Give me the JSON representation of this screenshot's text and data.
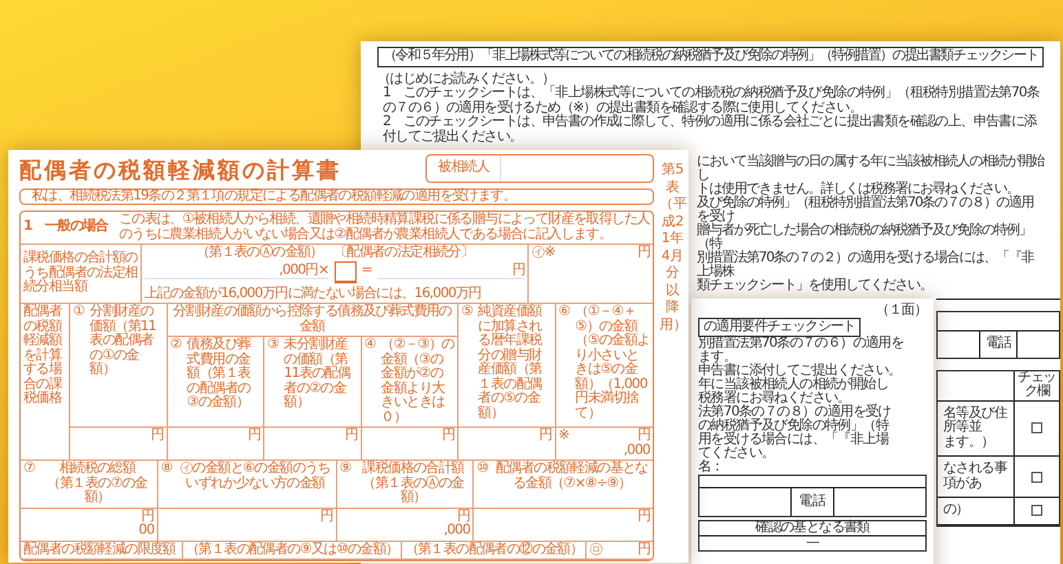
{
  "back_sheet": {
    "title": "（令和５年分用）「非上場株式等についての相続税の納税猶予及び免除の特例」（特例措置）の提出書類チェックシート",
    "intro": "（はじめにお読みください。）",
    "notes": [
      "1　このチェックシートは、「非上場株式等についての相続税の納税猶予及び免除の特例」（租税特別措置法第70条の７の６）の適用を受けるため（※）の提出書類を確認する際に使用してください。",
      "2　このチェックシートは、申告書の作成に際して、特例の適用に係る会社ごとに提出書類を確認の上、申告書に添付してご提出ください。"
    ],
    "note_fragments": [
      "において当該贈与の日の属する年に当該被相続人の相続が開始し",
      "トは使用できません。詳しくは税務署にお尋ねください。",
      "及び免除の特例」（租税特別措置法第70条の７の８）の適用を受け",
      "贈与者が死亡した場合の相続税の納税猶予及び免除の特例」（特",
      "別措置法第70条の７の２）の適用を受ける場合には、「『非上場株",
      "類チェックシート」を使用してください。"
    ],
    "phone_label": "電話",
    "check_table": {
      "header": "チェック欄",
      "rows": [
        {
          "lines": [
            "名等及び住所等並",
            "ます。）"
          ],
          "checked": false
        },
        {
          "lines": [
            "なされる事項があ"
          ],
          "checked": false
        },
        {
          "lines": [
            "の）"
          ],
          "checked": false
        }
      ]
    }
  },
  "middle_sheet": {
    "page_label": "（１面）",
    "title": "の適用要件チェックシート",
    "lines": [
      "別措置法第70条の７の６）の適用を",
      "ます。",
      "申告書に添付してご提出ください。",
      "年に当該被相続人の相続が開始し",
      "税務署にお尋ねください。",
      "法第70条の７の８）の適用を受け",
      "の納税猶予及び免除の特例」（特",
      "用を受ける場合には、「『非上場",
      "てください。"
    ],
    "name_label": "名：",
    "phone_label": "電話",
    "doc_header": "確認の基となる書類",
    "doc_row": "—"
  },
  "front_form": {
    "title": "配偶者の税額軽減額の計算書",
    "decedent_label": "被相続人",
    "side_label": "第5表（平成21年4月分以降用）",
    "declaration": "私は、相続税法第19条の２第１項の規定による配偶者の税額軽減の適用を受けます。",
    "section": {
      "label": "1　一般の場合",
      "note": "この表は、①被相続人から相続、遺贈や相続時精算課税に係る贈与によって財産を取得した人のうちに農業相続人がいない場合又は②配偶者が農業相続人である場合に記入します。"
    },
    "statutory_share": {
      "label": "課税価格の合計額のうち配偶者の法定相続分相当額",
      "source": "（第１表のⒶの金額）",
      "ratio_label": "〔配偶者の法定相続分〕",
      "amount_suffix": ",000円×",
      "equals": "=",
      "yen": "円",
      "floor_note": "上記の金額が16,000万円に満たない場合には、16,000万円",
      "result_mark": "㋑※",
      "result_yen": "円"
    },
    "taxable_value": {
      "label": "配偶者の税額軽減額を計算する場合の課税価格",
      "columns_before": [
        {
          "number": "①",
          "text": "分割財産の価額（第11表の配偶者の①の金額）",
          "unit": "円"
        }
      ],
      "group": {
        "label": "分割財産の価額から控除する債務及び葬式費用の金額",
        "columns": [
          {
            "number": "②",
            "text": "債務及び葬式費用の金額（第１表の配偶者の③の金額）",
            "unit": "円"
          },
          {
            "number": "③",
            "text": "未分割財産の価額（第11表の配偶者の②の金額）",
            "unit": "円"
          },
          {
            "number": "④",
            "text": "（②－③）の金額（③の金額が②の金額より大きいときは０）",
            "unit": "円"
          }
        ]
      },
      "columns_after": [
        {
          "number": "⑤",
          "text": "純資産価額に加算される暦年課税分の贈与財産価額（第１表の配偶者の⑤の金額）",
          "unit": "円"
        },
        {
          "number": "⑥",
          "text": "（①－④＋⑤）の金額（⑤の金額より小さいときは⑤の金額）（1,000円未満切捨て）",
          "mark": "※",
          "unit": "円",
          "value": ",000"
        }
      ]
    },
    "tax_rows": [
      {
        "number": "⑦",
        "text": "相続税の総額",
        "sub": "（第１表の⑦の金額）",
        "unit": "円",
        "value": "00"
      },
      {
        "number": "⑧",
        "text": "㋑の金額と⑥の金額のうちいずれか少ない方の金額",
        "unit": "円"
      },
      {
        "number": "⑨",
        "text": "課税価格の合計額",
        "sub": "（第１表のⒶの金額）",
        "unit": "円",
        "value": ",000"
      },
      {
        "number": "⑩",
        "text": "配偶者の税額軽減の基となる金額（⑦×⑧÷⑨）",
        "unit": "円"
      }
    ],
    "limit_row": {
      "label": "配偶者の税額軽減の限度額",
      "sources": [
        "（第１表の配偶者の⑨又は⑩の金額）",
        "（第１表の配偶者の⑫の金額）"
      ],
      "mark": "㋺",
      "unit": "円"
    }
  }
}
